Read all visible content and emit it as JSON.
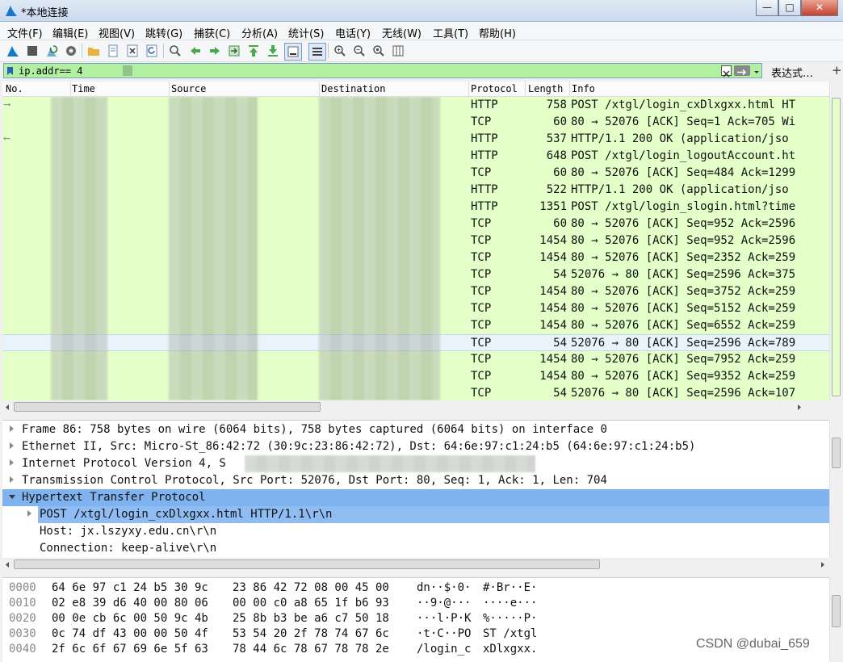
{
  "window": {
    "title": "*本地连接",
    "minimize": "—",
    "maximize": "□",
    "close": "✕"
  },
  "menu": [
    {
      "id": "file",
      "label": "文件(F)"
    },
    {
      "id": "edit",
      "label": "编辑(E)"
    },
    {
      "id": "view",
      "label": "视图(V)"
    },
    {
      "id": "go",
      "label": "跳转(G)"
    },
    {
      "id": "capture",
      "label": "捕获(C)"
    },
    {
      "id": "analyze",
      "label": "分析(A)"
    },
    {
      "id": "statistics",
      "label": "统计(S)"
    },
    {
      "id": "telephony",
      "label": "电话(Y)"
    },
    {
      "id": "wireless",
      "label": "无线(W)"
    },
    {
      "id": "tools",
      "label": "工具(T)"
    },
    {
      "id": "help",
      "label": "帮助(H)"
    }
  ],
  "filter": {
    "value": "ip.addr==            4",
    "expression_label": "表达式…",
    "add_label": "+"
  },
  "columns": {
    "no": "No.",
    "time": "Time",
    "source": "Source",
    "destination": "Destination",
    "protocol": "Protocol",
    "length": "Length",
    "info": "Info"
  },
  "packets": [
    {
      "protocol": "HTTP",
      "length": "758",
      "info": "POST /xtgl/login_cxDlxgxx.html HT"
    },
    {
      "protocol": "TCP",
      "length": "60",
      "info": "80 → 52076 [ACK] Seq=1 Ack=705 Wi"
    },
    {
      "protocol": "HTTP",
      "length": "537",
      "info": "HTTP/1.1 200 OK  (application/jso"
    },
    {
      "protocol": "HTTP",
      "length": "648",
      "info": "POST /xtgl/login_logoutAccount.ht"
    },
    {
      "protocol": "TCP",
      "length": "60",
      "info": "80 → 52076 [ACK] Seq=484 Ack=1299"
    },
    {
      "protocol": "HTTP",
      "length": "522",
      "info": "HTTP/1.1 200 OK  (application/jso"
    },
    {
      "protocol": "HTTP",
      "length": "1351",
      "info": "POST /xtgl/login_slogin.html?time"
    },
    {
      "protocol": "TCP",
      "length": "60",
      "info": "80 → 52076 [ACK] Seq=952 Ack=2596"
    },
    {
      "protocol": "TCP",
      "length": "1454",
      "info": "80 → 52076 [ACK] Seq=952 Ack=2596"
    },
    {
      "protocol": "TCP",
      "length": "1454",
      "info": "80 → 52076 [ACK] Seq=2352 Ack=259"
    },
    {
      "protocol": "TCP",
      "length": "54",
      "info": "52076 → 80 [ACK] Seq=2596 Ack=375"
    },
    {
      "protocol": "TCP",
      "length": "1454",
      "info": "80 → 52076 [ACK] Seq=3752 Ack=259"
    },
    {
      "protocol": "TCP",
      "length": "1454",
      "info": "80 → 52076 [ACK] Seq=5152 Ack=259"
    },
    {
      "protocol": "TCP",
      "length": "1454",
      "info": "80 → 52076 [ACK] Seq=6552 Ack=259"
    },
    {
      "protocol": "TCP",
      "length": "54",
      "info": "52076 → 80 [ACK] Seq=2596 Ack=789"
    },
    {
      "protocol": "TCP",
      "length": "1454",
      "info": "80 → 52076 [ACK] Seq=7952 Ack=259"
    },
    {
      "protocol": "TCP",
      "length": "1454",
      "info": "80 → 52076 [ACK] Seq=9352 Ack=259"
    },
    {
      "protocol": "TCP",
      "length": "54",
      "info": "52076 → 80 [ACK] Seq=2596 Ack=107"
    }
  ],
  "details": [
    {
      "text": "Frame 86: 758 bytes on wire (6064 bits), 758 bytes captured (6064 bits) on interface 0",
      "indent": 0,
      "arrow": "right"
    },
    {
      "text": "Ethernet II, Src: Micro-St_86:42:72 (30:9c:23:86:42:72), Dst: 64:6e:97:c1:24:b5 (64:6e:97:c1:24:b5)",
      "indent": 0,
      "arrow": "right"
    },
    {
      "text": "Internet Protocol Version 4, S",
      "indent": 0,
      "arrow": "right"
    },
    {
      "text": "Transmission Control Protocol, Src Port: 52076, Dst Port: 80, Seq: 1, Ack: 1, Len: 704",
      "indent": 0,
      "arrow": "right"
    },
    {
      "text": "Hypertext Transfer Protocol",
      "indent": 0,
      "arrow": "down"
    },
    {
      "text": "POST /xtgl/login_cxDlxgxx.html HTTP/1.1\\r\\n",
      "indent": 1,
      "arrow": "right"
    },
    {
      "text": "Host: jx.lszyxy.edu.cn\\r\\n",
      "indent": 1,
      "arrow": ""
    },
    {
      "text": "Connection: keep-alive\\r\\n",
      "indent": 1,
      "arrow": ""
    }
  ],
  "bytes": [
    {
      "offset": "0000",
      "hex1": "64 6e 97 c1 24 b5 30 9c",
      "hex2": "23 86 42 72 08 00 45 00",
      "asc1": "dn··$·0·",
      "asc2": "#·Br··E·"
    },
    {
      "offset": "0010",
      "hex1": "02 e8 39 d6 40 00 80 06",
      "hex2": "00 00 c0 a8 65 1f b6 93",
      "asc1": "··9·@···",
      "asc2": "····e···"
    },
    {
      "offset": "0020",
      "hex1": "00 0e cb 6c 00 50 9c 4b",
      "hex2": "25 8b b3 be a6 c7 50 18",
      "asc1": "···l·P·K",
      "asc2": "%·····P·"
    },
    {
      "offset": "0030",
      "hex1": "0c 74 df 43 00 00 50 4f",
      "hex2": "53 54 20 2f 78 74 67 6c",
      "asc1": "·t·C··PO",
      "asc2": "ST /xtgl"
    },
    {
      "offset": "0040",
      "hex1": "2f 6c 6f 67 69 6e 5f 63",
      "hex2": "78 44 6c 78 67 78 78 2e",
      "asc1": "/login_c",
      "asc2": "xDlxgxx."
    }
  ],
  "watermark": "CSDN @dubai_659",
  "colors": {
    "tcp_row": "#e4ffc7",
    "filter_ok": "#b0f0a0",
    "selected_detail": "#7fb3f0"
  }
}
